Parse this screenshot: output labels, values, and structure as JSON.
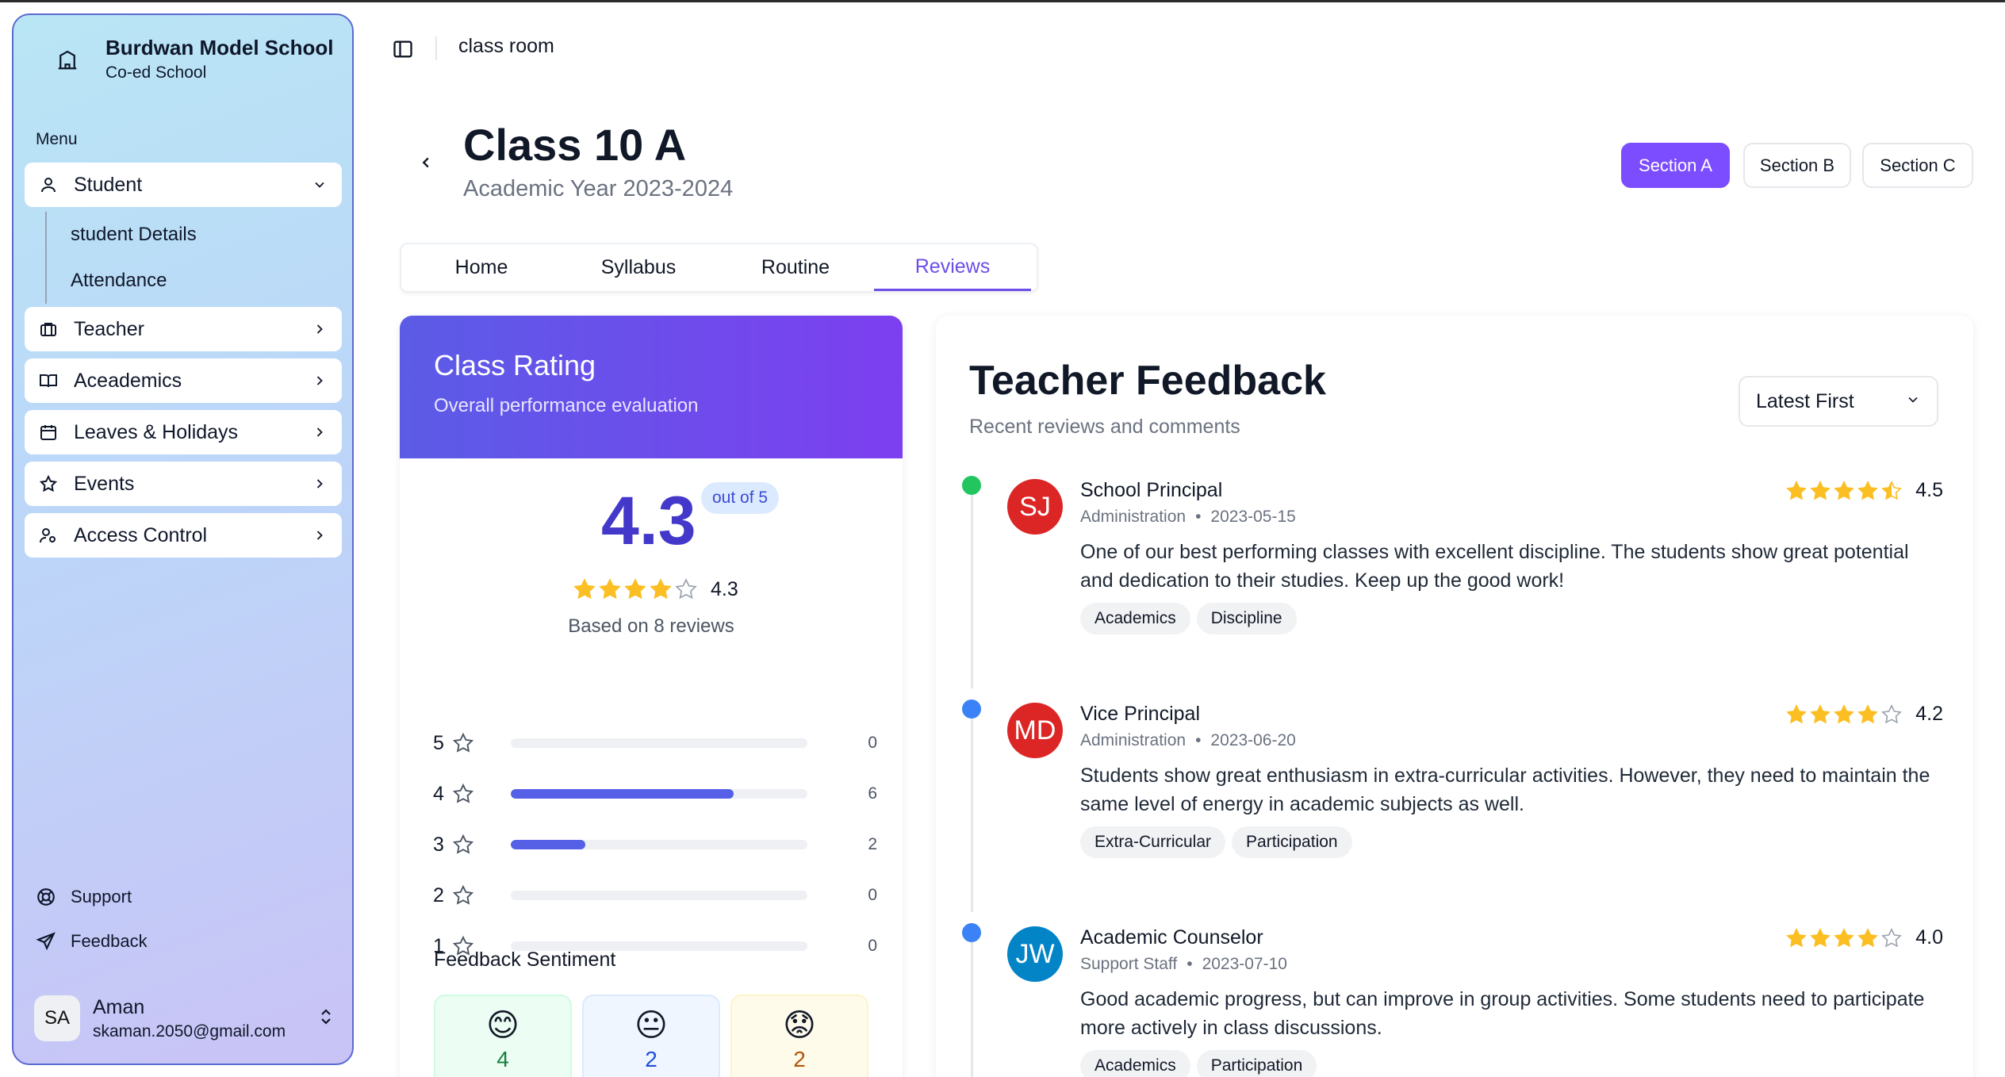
{
  "brand": {
    "name": "Burdwan Model School",
    "subtitle": "Co-ed School"
  },
  "menu_label": "Menu",
  "nav": {
    "student": "Student",
    "student_details": "student Details",
    "attendance": "Attendance",
    "teacher": "Teacher",
    "academics": "Aceademics",
    "leaves": "Leaves & Holidays",
    "events": "Events",
    "access": "Access Control"
  },
  "bottom_links": {
    "support": "Support",
    "feedback": "Feedback"
  },
  "user": {
    "initials": "SA",
    "name": "Aman",
    "email": "skaman.2050@gmail.com"
  },
  "header": {
    "breadcrumb": "class room"
  },
  "class": {
    "title": "Class 10 A",
    "year": "Academic Year 2023-2024"
  },
  "sections": {
    "a": "Section A",
    "b": "Section B",
    "c": "Section C",
    "active": "Section A"
  },
  "tabs": {
    "home": "Home",
    "syllabus": "Syllabus",
    "routine": "Routine",
    "reviews": "Reviews",
    "active": "Reviews"
  },
  "rating": {
    "title": "Class Rating",
    "subtitle": "Overall performance evaluation",
    "score": "4.3",
    "out_of": "out of 5",
    "stars_value": "4.3",
    "based_on": "Based on 8 reviews",
    "distribution": [
      {
        "stars": "5",
        "count": "0",
        "fraction": 0
      },
      {
        "stars": "4",
        "count": "6",
        "fraction": 0.75
      },
      {
        "stars": "3",
        "count": "2",
        "fraction": 0.25
      },
      {
        "stars": "2",
        "count": "0",
        "fraction": 0
      },
      {
        "stars": "1",
        "count": "0",
        "fraction": 0
      }
    ]
  },
  "sentiment": {
    "title": "Feedback Sentiment",
    "positive": {
      "emoji": "😊",
      "count": "4"
    },
    "neutral": {
      "emoji": "😐",
      "count": "2"
    },
    "negative": {
      "emoji": "😟",
      "count": "2"
    }
  },
  "feedback": {
    "title": "Teacher Feedback",
    "subtitle": "Recent reviews and comments",
    "sort": "Latest First",
    "items": [
      {
        "initials": "SJ",
        "name": "School Principal",
        "role": "Administration",
        "date": "2023-05-15",
        "rating": "4.5",
        "text": "One of our best performing classes with excellent discipline. The students show great potential and dedication to their studies. Keep up the good work!",
        "tags": [
          "Academics",
          "Discipline"
        ]
      },
      {
        "initials": "MD",
        "name": "Vice Principal",
        "role": "Administration",
        "date": "2023-06-20",
        "rating": "4.2",
        "text": "Students show great enthusiasm in extra-curricular activities. However, they need to maintain the same level of energy in academic subjects as well.",
        "tags": [
          "Extra-Curricular",
          "Participation"
        ]
      },
      {
        "initials": "JW",
        "name": "Academic Counselor",
        "role": "Support Staff",
        "date": "2023-07-10",
        "rating": "4.0",
        "text": "Good academic progress, but can improve in group activities. Some students need to participate more actively in class discussions.",
        "tags": [
          "Academics",
          "Participation"
        ]
      }
    ]
  },
  "colors": {
    "accent": "#7c4dff",
    "star": "#fbbf24",
    "dot_green": "#22c55e",
    "dot_blue": "#3b82f6",
    "avatar_red": "#dc2626",
    "avatar_blue": "#0284c7"
  }
}
